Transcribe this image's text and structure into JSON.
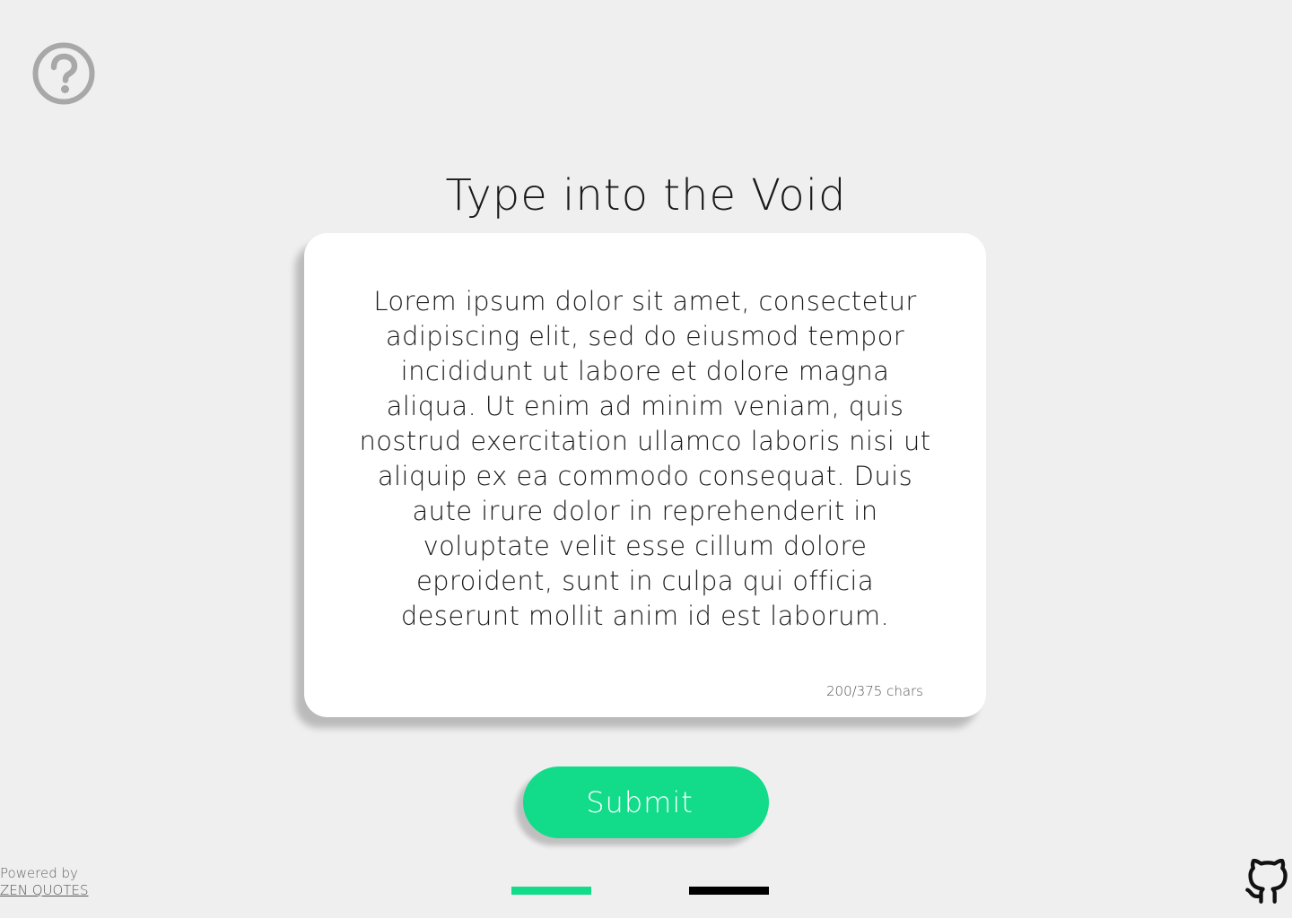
{
  "header": {
    "help_icon": "question-circle-icon",
    "title": "Type into the Void"
  },
  "card": {
    "text": "Lorem ipsum dolor sit amet, consectetur adipiscing elit, sed do eiusmod tempor incididunt ut labore et dolore magna aliqua. Ut enim ad minim veniam, quis nostrud exercitation ullamco laboris nisi ut aliquip ex ea commodo consequat. Duis aute irure dolor in reprehenderit in voluptate velit esse cillum dolore eproident, sunt in culpa qui officia deserunt mollit anim id est laborum.",
    "char_count": "200/375 chars"
  },
  "submit": {
    "label": "Submit",
    "color": "#12db8a"
  },
  "indicators": {
    "colors": [
      "#12db8a",
      "#000000"
    ]
  },
  "footer": {
    "powered_label": "Powered by",
    "powered_link": "ZEN QUOTES",
    "github_icon": "github-icon"
  },
  "colors": {
    "background": "#efefef",
    "card": "#ffffff",
    "accent": "#12db8a"
  }
}
